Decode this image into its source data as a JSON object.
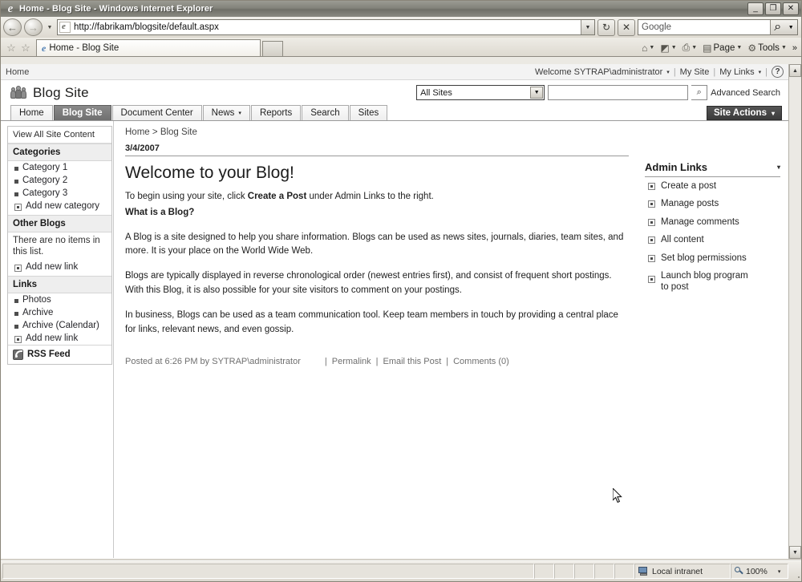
{
  "window": {
    "title": "Home - Blog Site - Windows Internet Explorer",
    "minimize": "_",
    "restore": "❐",
    "close": "✕"
  },
  "toolbar": {
    "back_icon": "←",
    "forward_icon": "→",
    "history_caret": "▼",
    "url": "http://fabrikam/blogsite/default.aspx",
    "url_caret": "▼",
    "refresh_icon": "↻",
    "stop_icon": "✕",
    "search_value": "Google",
    "search_go_icon": "⌕",
    "search_caret": "▼"
  },
  "tabs": {
    "favorites_icon": "☆",
    "addfav_icon": "☆",
    "open_tab": "Home - Blog Site",
    "new_tab_label": ""
  },
  "commandbar": {
    "items": [
      {
        "name": "home",
        "icon": "⌂",
        "label": "",
        "caret": "▼"
      },
      {
        "name": "feeds",
        "icon": "◩",
        "label": "",
        "caret": "▼"
      },
      {
        "name": "print",
        "icon": "⎙",
        "label": "",
        "caret": "▼"
      },
      {
        "name": "page",
        "icon": "▤",
        "label": "Page",
        "caret": "▼"
      },
      {
        "name": "tools",
        "icon": "⚙",
        "label": "Tools",
        "caret": "▼"
      }
    ],
    "overflow": "»"
  },
  "topstrip": {
    "home_link": "Home",
    "welcome": "Welcome SYTRAP\\administrator",
    "welcome_caret": "▾",
    "my_site": "My Site",
    "my_links": "My Links",
    "my_links_caret": "▾",
    "separator": "|",
    "help_icon": "?"
  },
  "site": {
    "title": "Blog Site",
    "logo_name": "people-icon"
  },
  "search": {
    "scope_selected": "All Sites",
    "scope_caret": "▼",
    "query": "",
    "go_icon": "⌕",
    "advanced_label": "Advanced Search"
  },
  "nav": {
    "tabs": [
      {
        "label": "Home",
        "active": false,
        "caret": ""
      },
      {
        "label": "Blog Site",
        "active": true,
        "caret": ""
      },
      {
        "label": "Document Center",
        "active": false,
        "caret": ""
      },
      {
        "label": "News",
        "active": false,
        "caret": "▾"
      },
      {
        "label": "Reports",
        "active": false,
        "caret": ""
      },
      {
        "label": "Search",
        "active": false,
        "caret": ""
      },
      {
        "label": "Sites",
        "active": false,
        "caret": ""
      }
    ],
    "site_actions": "Site Actions",
    "site_actions_caret": "▾"
  },
  "quicklaunch": {
    "view_all": "View All Site Content",
    "sections": [
      {
        "heading": "Categories",
        "items": [
          {
            "label": "Category 1",
            "type": "bullet"
          },
          {
            "label": "Category 2",
            "type": "bullet"
          },
          {
            "label": "Category 3",
            "type": "bullet"
          },
          {
            "label": "Add new category",
            "type": "add"
          }
        ],
        "note": ""
      },
      {
        "heading": "Other Blogs",
        "items": [
          {
            "label": "Add new link",
            "type": "add"
          }
        ],
        "note": "There are no items in this list."
      },
      {
        "heading": "Links",
        "items": [
          {
            "label": "Photos",
            "type": "bullet"
          },
          {
            "label": "Archive",
            "type": "bullet"
          },
          {
            "label": "Archive (Calendar)",
            "type": "bullet"
          },
          {
            "label": "Add new link",
            "type": "add"
          }
        ],
        "note": ""
      }
    ],
    "rss_label": "RSS Feed"
  },
  "breadcrumb": {
    "home": "Home",
    "separator": ">",
    "current": "Blog Site"
  },
  "post": {
    "date": "3/4/2007",
    "title": "Welcome to your Blog!",
    "intro_prefix": "To begin using your site, click ",
    "intro_bold": "Create a Post",
    "intro_suffix": " under Admin Links to the right.",
    "subheading": "What is a Blog?",
    "paragraphs": [
      "A Blog is a site designed to help you share information. Blogs can be used as news sites, journals, diaries, team sites, and more. It is your place on the World Wide Web.",
      "Blogs are typically displayed in reverse chronological order (newest entries first), and consist of frequent short postings. With this Blog, it is also possible for your site visitors to comment on your postings.",
      "In business, Blogs can be used as a team communication tool. Keep team members in touch by providing a central place for links, relevant news, and even gossip."
    ],
    "meta_posted": "Posted at 6:26 PM by SYTRAP\\administrator",
    "meta_permalink": "Permalink",
    "meta_email": "Email this Post",
    "meta_comments": "Comments (0)",
    "meta_divider": "|"
  },
  "admin_links": {
    "heading": "Admin Links",
    "heading_caret": "▾",
    "items": [
      "Create a post",
      "Manage posts",
      "Manage comments",
      "All content",
      "Set blog permissions",
      "Launch blog program to post"
    ]
  },
  "scrollbar": {
    "up_icon": "▲",
    "down_icon": "▼"
  },
  "statusbar": {
    "message": "",
    "zone": "Local intranet",
    "zoom": "100%",
    "zoom_caret": "▾"
  }
}
